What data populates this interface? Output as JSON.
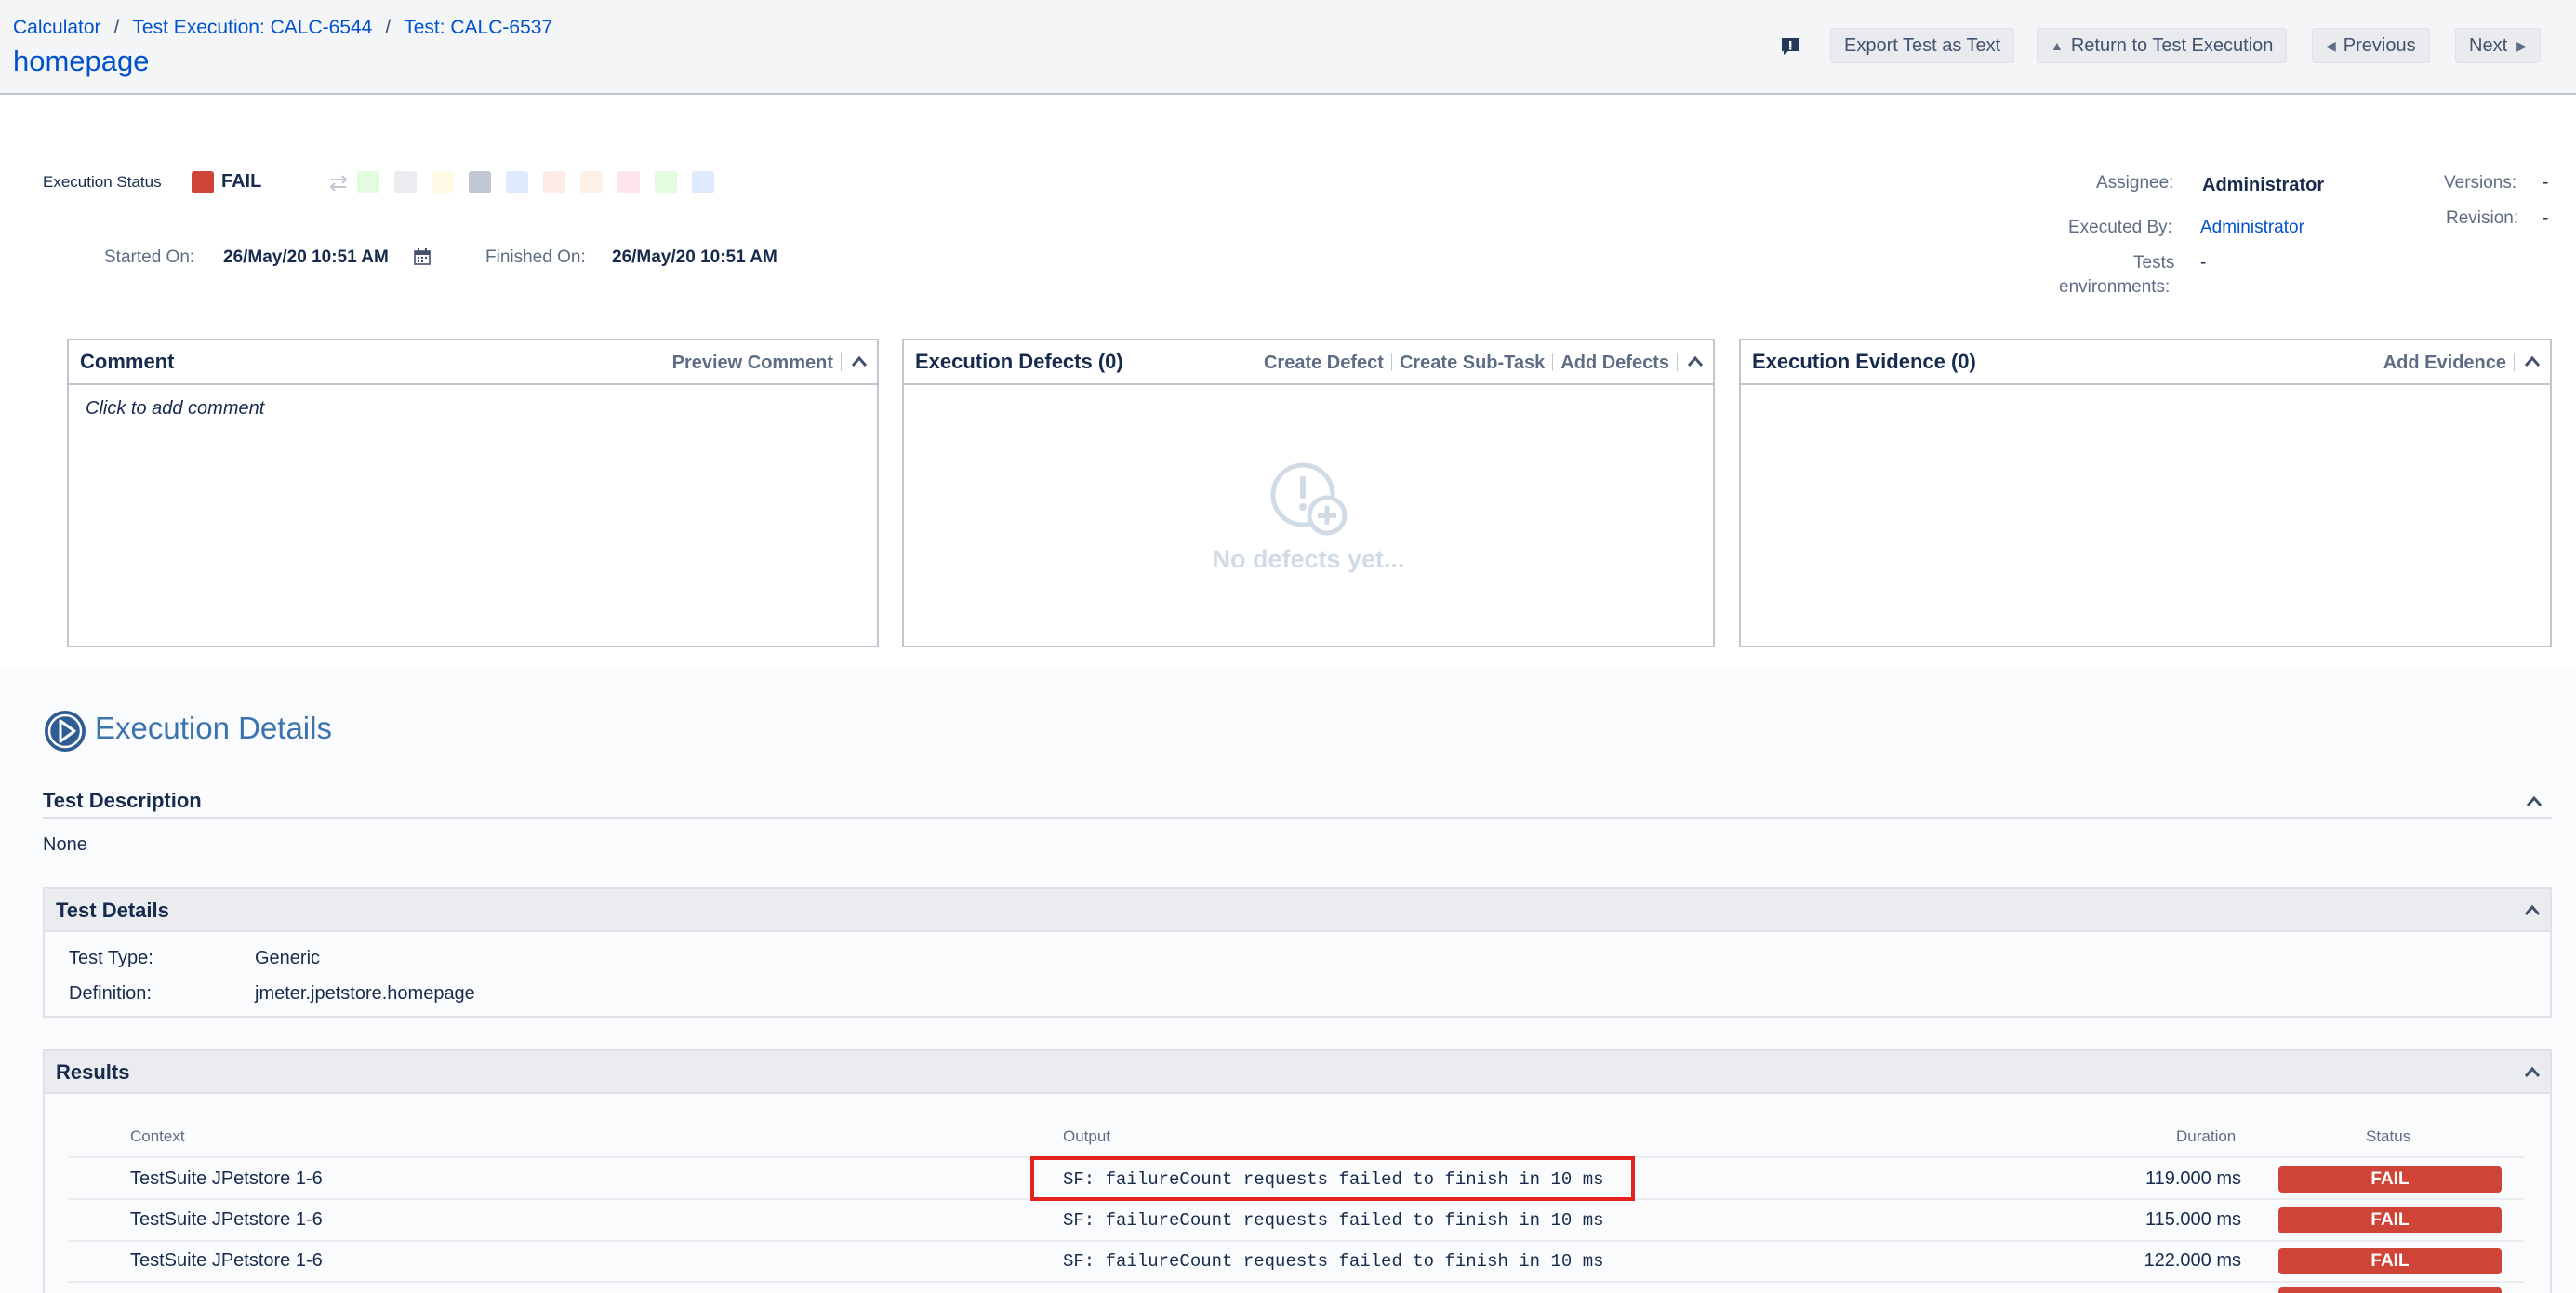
{
  "breadcrumbs": [
    "Calculator",
    "Test Execution: CALC-6544",
    "Test: CALC-6537"
  ],
  "page_title": "homepage",
  "header_buttons": {
    "export": "Export Test as Text",
    "return": "Return to Test Execution",
    "previous": "Previous",
    "next": "Next"
  },
  "status": {
    "label": "Execution Status",
    "value": "FAIL",
    "value_color": "#d04437",
    "swatch_colors": [
      "#e3fcef",
      "#ebecf0",
      "#fffae6",
      "#c1c7d0",
      "#deebff",
      "#ffebe6",
      "#fff0e6",
      "#ffe5ef",
      "#e3fcdf",
      "#deebff"
    ]
  },
  "dates": {
    "started_label": "Started On:",
    "started_value": "26/May/20 10:51 AM",
    "finished_label": "Finished On:",
    "finished_value": "26/May/20 10:51 AM"
  },
  "people": {
    "assignee_label": "Assignee:",
    "assignee_value": "Administrator",
    "executed_by_label": "Executed By:",
    "executed_by_value": "Administrator",
    "tests_env_label_1": "Tests",
    "tests_env_label_2": "environments:",
    "tests_env_value": "-",
    "versions_label": "Versions:",
    "versions_value": "-",
    "revision_label": "Revision:",
    "revision_value": "-"
  },
  "panels": {
    "comment": {
      "title": "Comment",
      "action": "Preview Comment",
      "placeholder": "Click to add comment"
    },
    "defects": {
      "title": "Execution Defects (0)",
      "actions": [
        "Create Defect",
        "Create Sub-Task",
        "Add Defects"
      ],
      "empty": "No defects yet..."
    },
    "evidence": {
      "title": "Execution Evidence (0)",
      "action": "Add Evidence"
    }
  },
  "execution_details": {
    "title": "Execution Details",
    "test_description_title": "Test Description",
    "test_description_value": "None",
    "test_details_title": "Test Details",
    "test_type_label": "Test Type:",
    "test_type_value": "Generic",
    "definition_label": "Definition:",
    "definition_value": "jmeter.jpetstore.homepage",
    "results_title": "Results"
  },
  "results": {
    "columns": [
      "Context",
      "Output",
      "Duration",
      "Status"
    ],
    "rows": [
      {
        "context": "TestSuite JPetstore 1-6",
        "output": "SF: failureCount requests failed to finish in 10 ms",
        "duration": "119.000 ms",
        "status": "FAIL"
      },
      {
        "context": "TestSuite JPetstore 1-6",
        "output": "SF: failureCount requests failed to finish in 10 ms",
        "duration": "115.000 ms",
        "status": "FAIL"
      },
      {
        "context": "TestSuite JPetstore 1-6",
        "output": "SF: failureCount requests failed to finish in 10 ms",
        "duration": "122.000 ms",
        "status": "FAIL"
      }
    ]
  }
}
